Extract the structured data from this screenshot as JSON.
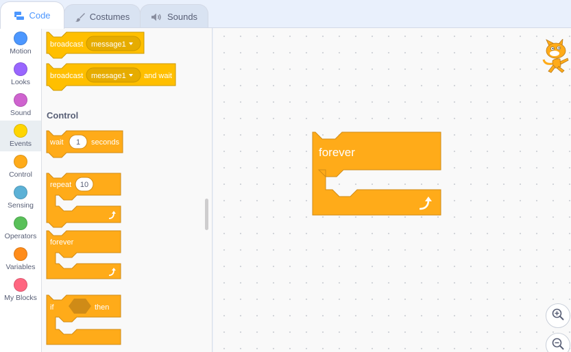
{
  "tabs": {
    "code": "Code",
    "costumes": "Costumes",
    "sounds": "Sounds"
  },
  "categories": [
    {
      "label": "Motion",
      "color": "#4c97ff"
    },
    {
      "label": "Looks",
      "color": "#9966ff"
    },
    {
      "label": "Sound",
      "color": "#cf63cf"
    },
    {
      "label": "Events",
      "color": "#ffd500"
    },
    {
      "label": "Control",
      "color": "#ffab19"
    },
    {
      "label": "Sensing",
      "color": "#5cb1d6"
    },
    {
      "label": "Operators",
      "color": "#59c059"
    },
    {
      "label": "Variables",
      "color": "#ff8c1a"
    },
    {
      "label": "My Blocks",
      "color": "#ff6680"
    }
  ],
  "selected_category": "Events",
  "palette": {
    "broadcast_label": "broadcast",
    "broadcast_message": "message1",
    "broadcast_wait_label": "broadcast",
    "broadcast_wait_message": "message1",
    "broadcast_wait_suffix": "and wait",
    "control_heading": "Control",
    "wait_label": "wait",
    "wait_value": "1",
    "wait_suffix": "seconds",
    "repeat_label": "repeat",
    "repeat_value": "10",
    "forever_label": "forever",
    "if_label": "if",
    "if_then": "then"
  },
  "workspace": {
    "forever_label": "forever"
  },
  "colors": {
    "events": "#ffbf00",
    "events_dark": "#cc9900",
    "control": "#ffab19",
    "control_dark": "#cf8b17",
    "accent": "#4c97ff"
  },
  "icons": {
    "code_tab": "code-blocks-icon",
    "costumes_tab": "paintbrush-icon",
    "sounds_tab": "speaker-icon",
    "loop_arrow": "loop-arrow-icon",
    "zoom_in": "zoom-in-icon",
    "zoom_out": "zoom-out-icon",
    "sprite": "cat-sprite-icon"
  }
}
